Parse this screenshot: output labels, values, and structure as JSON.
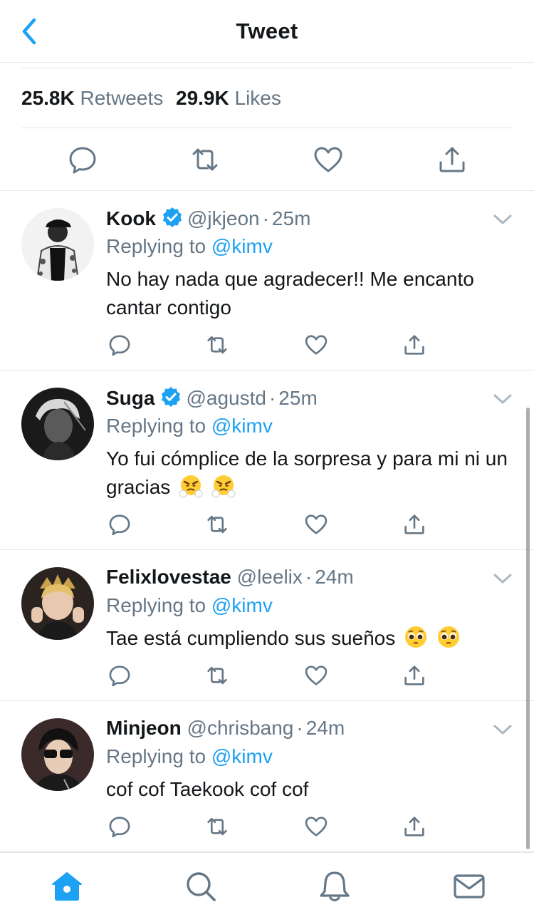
{
  "header": {
    "title": "Tweet"
  },
  "stats": {
    "retweets_count": "25.8K",
    "retweets_label": "Retweets",
    "likes_count": "29.9K",
    "likes_label": "Likes"
  },
  "colors": {
    "accent": "#1da1f2",
    "secondary": "#657786",
    "text": "#14171a",
    "divider": "#e1e8ed"
  },
  "replies": [
    {
      "name": "Kook",
      "verified": true,
      "handle": "@jkjeon",
      "dot": "·",
      "time": "25m",
      "replying_prefix": "Replying to",
      "replying_to": "@kimv",
      "text": "No hay nada que agradecer!! Me encanto cantar contigo"
    },
    {
      "name": "Suga",
      "verified": true,
      "handle": "@agustd",
      "dot": "·",
      "time": "25m",
      "replying_prefix": "Replying to",
      "replying_to": "@kimv",
      "text": "Yo fui cómplice de la sorpresa y para mi ni un gracias"
    },
    {
      "name": "Felixlovestae",
      "verified": false,
      "handle": "@leelix",
      "dot": "·",
      "time": "24m",
      "replying_prefix": "Replying to",
      "replying_to": "@kimv",
      "text": "Tae está cumpliendo sus sueños"
    },
    {
      "name": "Minjeon",
      "verified": false,
      "handle": "@chrisbang",
      "dot": "·",
      "time": "24m",
      "replying_prefix": "Replying to",
      "replying_to": "@kimv",
      "text": "cof cof Taekook cof cof"
    }
  ],
  "icons": {
    "back": "chevron-left-icon",
    "reply": "reply-icon",
    "retweet": "retweet-icon",
    "like": "heart-icon",
    "share": "share-icon",
    "more": "chevron-down-icon",
    "tabs": [
      "home-icon",
      "search-icon",
      "bell-icon",
      "mail-icon"
    ]
  }
}
